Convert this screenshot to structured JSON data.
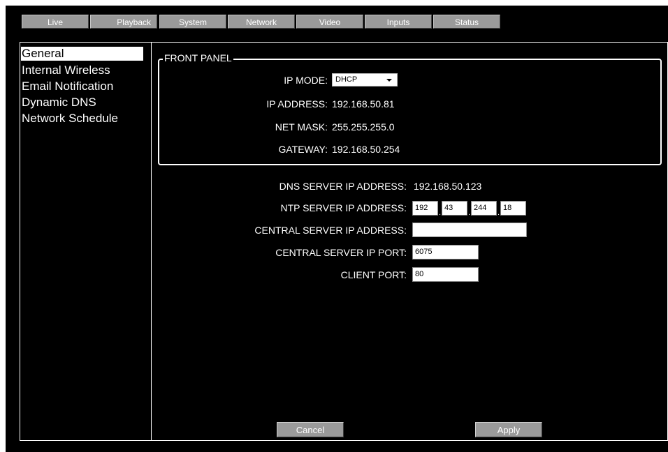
{
  "tabs": {
    "live": "Live",
    "playback": "Playback",
    "system": "System",
    "network": "Network",
    "video": "Video",
    "inputs": "Inputs",
    "status": "Status"
  },
  "sidebar": {
    "items": [
      {
        "label": "General",
        "active": true
      },
      {
        "label": "Internal Wireless"
      },
      {
        "label": "Email Notification"
      },
      {
        "label": "Dynamic DNS"
      },
      {
        "label": "Network Schedule"
      }
    ]
  },
  "front_panel": {
    "legend": "FRONT PANEL",
    "ip_mode_label": "IP MODE:",
    "ip_mode_value": "DHCP",
    "ip_address_label": "IP ADDRESS:",
    "ip_address_value": "192.168.50.81",
    "net_mask_label": "NET MASK:",
    "net_mask_value": "255.255.255.0",
    "gateway_label": "GATEWAY:",
    "gateway_value": "192.168.50.254"
  },
  "server": {
    "dns_label": "DNS SERVER IP ADDRESS:",
    "dns_value": "192.168.50.123",
    "ntp_label": "NTP SERVER IP ADDRESS:",
    "ntp_octets": [
      "192",
      "43",
      "244",
      "18"
    ],
    "central_ip_label": "CENTRAL SERVER IP ADDRESS:",
    "central_ip_value": "",
    "central_port_label": "CENTRAL SERVER IP PORT:",
    "central_port_value": "6075",
    "client_port_label": "CLIENT PORT:",
    "client_port_value": "80"
  },
  "buttons": {
    "cancel": "Cancel",
    "apply": "Apply"
  },
  "colors": {
    "background": "#000000",
    "tab": "#9a9a9a",
    "text": "#ffffff"
  }
}
